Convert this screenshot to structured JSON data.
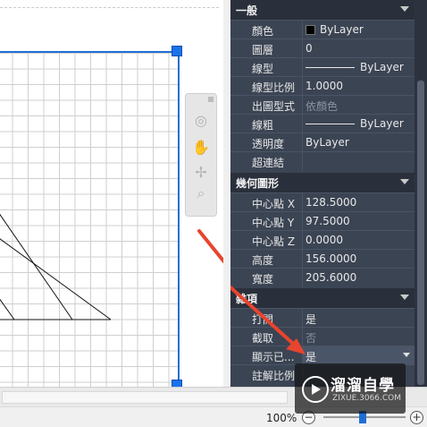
{
  "properties": {
    "sections": [
      {
        "id": "general",
        "title": "一般",
        "rows": [
          {
            "label": "顏色",
            "value": "ByLayer"
          },
          {
            "label": "圖層",
            "value": "0"
          },
          {
            "label": "線型",
            "value": "ByLayer"
          },
          {
            "label": "線型比例",
            "value": "1.0000"
          },
          {
            "label": "出圖型式",
            "value": "依顏色"
          },
          {
            "label": "線粗",
            "value": "ByLayer"
          },
          {
            "label": "透明度",
            "value": "ByLayer"
          },
          {
            "label": "超連結",
            "value": ""
          }
        ]
      },
      {
        "id": "geometry",
        "title": "幾何圖形",
        "rows": [
          {
            "label": "中心點 X",
            "value": "128.5000"
          },
          {
            "label": "中心點 Y",
            "value": "97.5000"
          },
          {
            "label": "中心點 Z",
            "value": "0.0000"
          },
          {
            "label": "高度",
            "value": "156.0000"
          },
          {
            "label": "寬度",
            "value": "205.6000"
          }
        ]
      },
      {
        "id": "misc",
        "title": "雜項",
        "rows": [
          {
            "label": "打開",
            "value": "是"
          },
          {
            "label": "截取",
            "value": "否"
          },
          {
            "label": "顯示已...",
            "value": "是"
          },
          {
            "label": "註解比例",
            "value": ""
          }
        ]
      }
    ]
  },
  "status_bar": {
    "zoom": "100%",
    "minus": "−",
    "plus": "+"
  },
  "watermark": {
    "name": "溜溜自學",
    "url": "ZIXUE.3066.COM"
  },
  "colors": {
    "accent": "#1f6fd6",
    "panel_bg": "#3b4453",
    "section_bg": "#2a303b",
    "annotation_arrow": "#e8442e"
  }
}
